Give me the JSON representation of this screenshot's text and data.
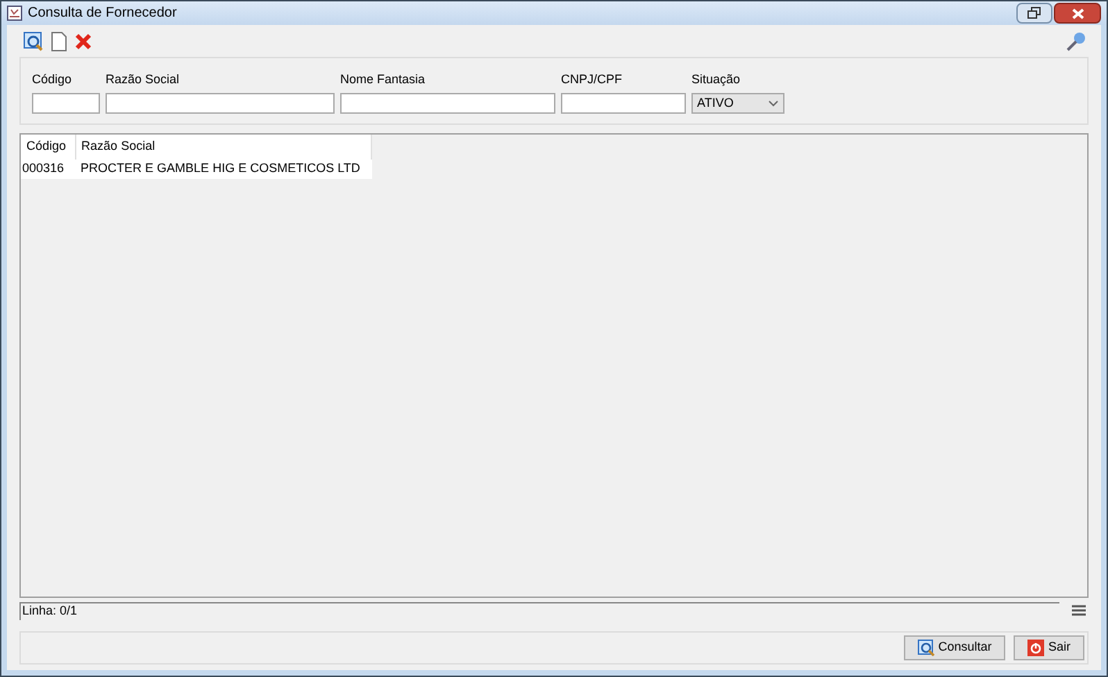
{
  "window": {
    "title": "Consulta de Fornecedor"
  },
  "filters": [
    {
      "label": "Código",
      "kind": "text"
    },
    {
      "label": "Razão Social",
      "kind": "text"
    },
    {
      "label": "Nome Fantasia",
      "kind": "text"
    },
    {
      "label": "CNPJ/CPF",
      "kind": "text"
    },
    {
      "label": "Situação",
      "kind": "select",
      "value": "ATIVO"
    }
  ],
  "table": {
    "columns": [
      "Código",
      "Razão Social"
    ],
    "rows": [
      [
        "000316",
        "PROCTER E GAMBLE HIG E COSMETICOS LTD"
      ]
    ]
  },
  "status_bar": {
    "text": "Linha: 0/1"
  },
  "buttons": [
    {
      "label": "Consultar",
      "kind": "search"
    },
    {
      "label": "Sair",
      "kind": "exit"
    }
  ]
}
